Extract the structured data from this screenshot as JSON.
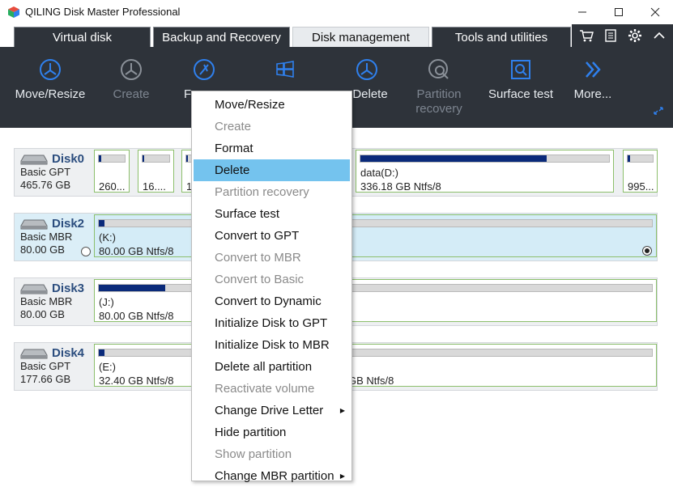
{
  "window": {
    "title": "QILING Disk Master Professional"
  },
  "tabs": [
    {
      "label": "Virtual disk"
    },
    {
      "label": "Backup and Recovery"
    },
    {
      "label": "Disk management"
    },
    {
      "label": "Tools and utilities"
    }
  ],
  "toolbar": [
    {
      "label": "Move/Resize",
      "icon": "move-resize-icon",
      "enabled": true
    },
    {
      "label": "Create",
      "icon": "create-partition-icon",
      "enabled": false
    },
    {
      "label": "F",
      "icon": "format-icon",
      "enabled": true
    },
    {
      "label": "",
      "icon": "windows-icon",
      "enabled": true
    },
    {
      "label": "Delete",
      "icon": "delete-partition-icon",
      "enabled": true
    },
    {
      "label": "Partition\nrecovery",
      "icon": "partition-recovery-icon",
      "enabled": false
    },
    {
      "label": "Surface test",
      "icon": "surface-test-icon",
      "enabled": true
    },
    {
      "label": "More...",
      "icon": "chevron-double-right-icon",
      "enabled": true
    }
  ],
  "disks": [
    {
      "name": "Disk0",
      "type": "Basic GPT",
      "size": "465.76 GB",
      "partitions": [
        {
          "label": "",
          "info": "260...",
          "fill": 0.1
        },
        {
          "label": "",
          "info": "16....",
          "fill": 0.05
        },
        {
          "label": "",
          "info": "1",
          "fill": 0.1
        },
        {
          "label": "data(D:)",
          "info": "336.18 GB Ntfs/8",
          "fill": 0.75
        },
        {
          "label": "",
          "info": "995...",
          "fill": 0.1
        }
      ]
    },
    {
      "name": "Disk2",
      "type": "Basic MBR",
      "size": "80.00 GB",
      "partitions": [
        {
          "label": "(K:)",
          "info": "80.00 GB Ntfs/8",
          "fill": 0.01
        }
      ]
    },
    {
      "name": "Disk3",
      "type": "Basic MBR",
      "size": "80.00 GB",
      "partitions": [
        {
          "label": "(J:)",
          "info": "80.00 GB Ntfs/8",
          "fill": 0.12
        }
      ]
    },
    {
      "name": "Disk4",
      "type": "Basic GPT",
      "size": "177.66 GB",
      "partitions": [
        {
          "label": "(E:)",
          "info": "32.40 GB Ntfs/8",
          "fill": 0.01
        },
        {
          "label": "",
          "info": "GB Ntfs/8",
          "fill": 0.01
        }
      ]
    }
  ],
  "context_menu": [
    {
      "label": "Move/Resize",
      "enabled": true
    },
    {
      "label": "Create",
      "enabled": false
    },
    {
      "label": "Format",
      "enabled": true
    },
    {
      "label": "Delete",
      "enabled": true,
      "highlighted": true
    },
    {
      "label": "Partition recovery",
      "enabled": false
    },
    {
      "label": "Surface test",
      "enabled": true
    },
    {
      "label": "Convert to GPT",
      "enabled": true
    },
    {
      "label": "Convert to MBR",
      "enabled": false
    },
    {
      "label": "Convert to Basic",
      "enabled": false
    },
    {
      "label": "Convert to Dynamic",
      "enabled": true
    },
    {
      "label": "Initialize Disk to GPT",
      "enabled": true
    },
    {
      "label": "Initialize Disk to MBR",
      "enabled": true
    },
    {
      "label": "Delete all partition",
      "enabled": true
    },
    {
      "label": "Reactivate volume",
      "enabled": false
    },
    {
      "label": "Change Drive Letter",
      "enabled": true,
      "submenu": true
    },
    {
      "label": "Hide partition",
      "enabled": true
    },
    {
      "label": "Show partition",
      "enabled": false
    },
    {
      "label": "Change MBR partition",
      "enabled": true,
      "submenu": true
    }
  ],
  "colors": {
    "toolbar_bg": "#2e333a",
    "highlight": "#74c3ee",
    "bar_fill": "#0a2a7a",
    "partition_border": "#8cbf6c"
  }
}
